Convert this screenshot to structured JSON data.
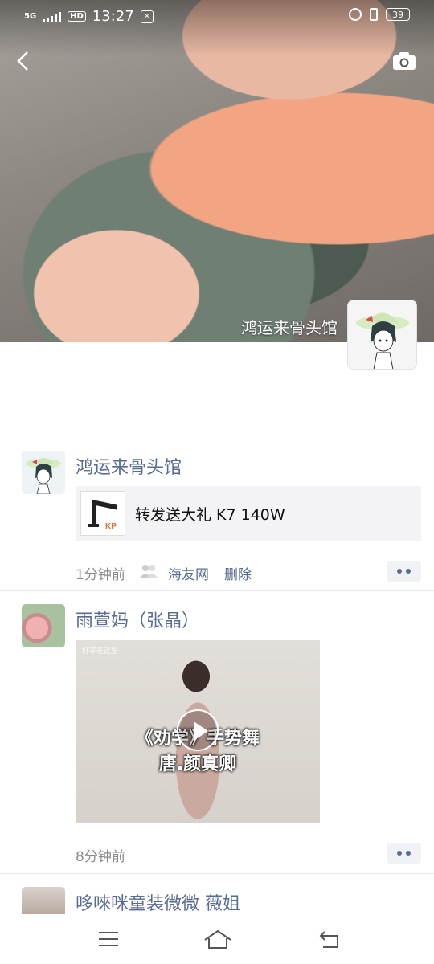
{
  "status_bar": {
    "network": "5G",
    "hd": "HD",
    "time": "13:27",
    "battery": "39"
  },
  "cover": {
    "name": "鸿运来骨头馆"
  },
  "posts": [
    {
      "name": "鸿运来骨头馆",
      "share_title": "转发送大礼 K7 140W",
      "time": "1分钟前",
      "source": "海友网",
      "delete_label": "删除"
    },
    {
      "name": "雨萱妈（张晶）",
      "video_brand": "好字在这里",
      "video_line1": "《劝学》手势舞",
      "video_line2": "唐.颜真卿",
      "time": "8分钟前"
    },
    {
      "name": "哆唻咪童装微微 薇姐"
    }
  ],
  "colors": {
    "link": "#576b95",
    "meta": "#8b8b8b"
  }
}
